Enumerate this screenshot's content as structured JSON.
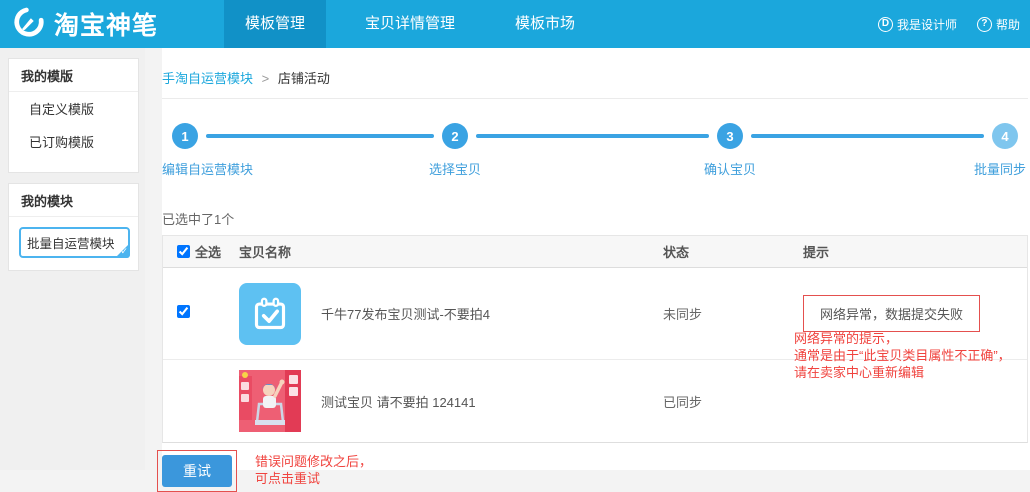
{
  "header": {
    "logo_text": "淘宝神笔",
    "nav": [
      {
        "label": "模板管理",
        "active": true
      },
      {
        "label": "宝贝详情管理",
        "active": false
      },
      {
        "label": "模板市场",
        "active": false
      }
    ],
    "right": {
      "designer_glyph": "D",
      "designer_label": "我是设计师",
      "help_glyph": "?",
      "help_label": "帮助"
    }
  },
  "sidebar": {
    "sections": [
      {
        "title": "我的模版",
        "items": [
          {
            "label": "自定义模版"
          },
          {
            "label": "已订购模版"
          }
        ]
      },
      {
        "title": "我的模块",
        "items": [
          {
            "label": "批量自运营模块"
          }
        ]
      }
    ],
    "selected_badge_glyph": "✓"
  },
  "breadcrumb": {
    "link": "手淘自运营模块",
    "separator": ">",
    "current": "店铺活动"
  },
  "steps": [
    {
      "num": "1",
      "label": "编辑自运营模块"
    },
    {
      "num": "2",
      "label": "选择宝贝"
    },
    {
      "num": "3",
      "label": "确认宝贝"
    },
    {
      "num": "4",
      "label": "批量同步"
    }
  ],
  "main": {
    "selection_summary": "已选中了1个"
  },
  "table": {
    "headers": {
      "select_all": "全选",
      "name": "宝贝名称",
      "status": "状态",
      "tip": "提示"
    },
    "select_all_checked": "checked",
    "rows": [
      {
        "name": "千牛77发布宝贝测试-不要拍4",
        "status": "未同步",
        "tip": "网络异常，数据提交失败",
        "checked": "checked"
      },
      {
        "name": "测试宝贝 请不要拍 124141",
        "status": "已同步",
        "tip": ""
      }
    ]
  },
  "annotations": {
    "tip_line1": "网络异常的提示，",
    "tip_line2": "通常是由于“此宝贝类目属性不正确”，",
    "tip_line3": "请在卖家中心重新编辑",
    "retry_line1": "错误问题修改之后，",
    "retry_line2": "可点击重试"
  },
  "retry": {
    "label": "重试"
  },
  "colors": {
    "header_blue": "#1ba7dc",
    "active_tab_blue": "#1191c7",
    "step_blue": "#3aa3e3",
    "step_light_blue": "#7fc6ee",
    "button_blue": "#3b97dc",
    "calendar_blue": "#5ec1f2",
    "annotation_red": "#f0433e",
    "tip_border_red": "#e4504e"
  }
}
